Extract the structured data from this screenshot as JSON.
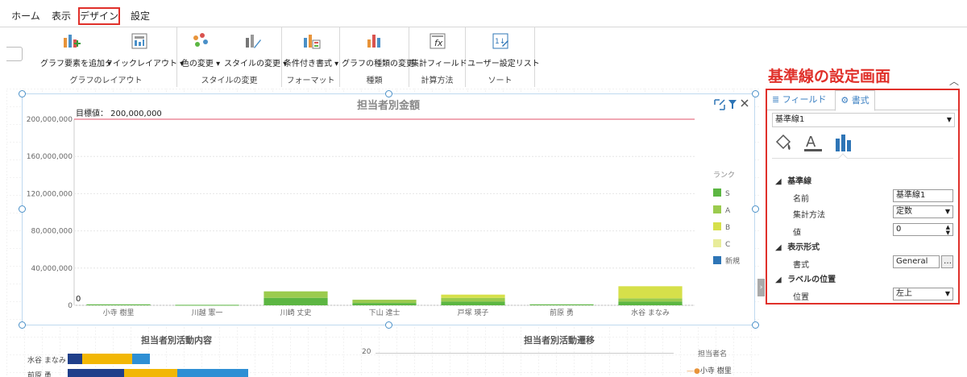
{
  "menu": {
    "tabs": [
      {
        "label": "ホーム"
      },
      {
        "label": "表示"
      },
      {
        "label": "デザイン"
      },
      {
        "label": "設定"
      }
    ]
  },
  "ribbon": {
    "buttons": {
      "add_element": "グラフ要素を追加",
      "quick_layout": "クイックレイアウト",
      "color_change": "色の変更",
      "style_change": "スタイルの変更",
      "conditional_format": "条件付き書式",
      "chart_type_change": "グラフの種類の変更",
      "calc_field": "集計フィールド",
      "user_sort_list": "ユーザー設定リスト"
    },
    "groups": {
      "layout": "グラフのレイアウト",
      "style": "スタイルの変更",
      "format": "フォーマット",
      "type": "種類",
      "calc": "計算方法",
      "sort": "ソート"
    }
  },
  "panel_title": "基準線の設定画面",
  "panel": {
    "tab_field": "フィールド",
    "tab_format": "書式",
    "selected_line": "基準線1",
    "sections": {
      "baseline": "基準線",
      "display_format": "表示形式",
      "label_position": "ラベルの位置"
    },
    "props": {
      "name_label": "名前",
      "name_value": "基準線1",
      "method_label": "集計方法",
      "method_value": "定数",
      "value_label": "値",
      "value_value": "0",
      "format_label": "書式",
      "format_value": "General",
      "position_label": "位置",
      "position_value": "左上"
    }
  },
  "chart_data": {
    "type": "bar",
    "title": "担当者別金額",
    "categories": [
      "小寺 樹里",
      "川越 憲一",
      "川崎 丈史",
      "下山 達士",
      "戸塚 瑛子",
      "前原 勇",
      "水谷 まなみ"
    ],
    "series": [
      {
        "name": "S",
        "color": "#5cb642",
        "values": [
          1000000,
          500000,
          8000000,
          2500000,
          4000000,
          1000000,
          4000000
        ]
      },
      {
        "name": "A",
        "color": "#9bcb4e",
        "values": [
          0,
          0,
          7000000,
          3500000,
          4000000,
          0,
          3500000
        ]
      },
      {
        "name": "B",
        "color": "#d6e04a",
        "values": [
          0,
          0,
          0,
          0,
          3500000,
          0,
          13000000
        ]
      },
      {
        "name": "C",
        "color": "#e8ec9a",
        "values": [
          0,
          0,
          0,
          0,
          0,
          0,
          0
        ]
      },
      {
        "name": "新規",
        "color": "#2e75b6",
        "values": [
          0,
          0,
          0,
          0,
          0,
          0,
          0
        ]
      }
    ],
    "legend_title": "ランク",
    "ylim": [
      0,
      200000000
    ],
    "yticks": [
      "200,000,000",
      "160,000,000",
      "120,000,000",
      "80,000,000",
      "40,000,000",
      "0"
    ],
    "reference_line": {
      "label": "目標値： 200,000,000",
      "value": 200000000
    },
    "zero_label": "0",
    "grid": true,
    "legend_position": "right"
  },
  "lower_charts": {
    "left_title": "担当者別活動内容",
    "left_rows": [
      "水谷 まなみ",
      "前原 勇"
    ],
    "right_title": "担当者別活動遷移",
    "right_ytick": "20",
    "right_legend_title": "担当者名",
    "right_legend_item": "小寺 樹里"
  }
}
